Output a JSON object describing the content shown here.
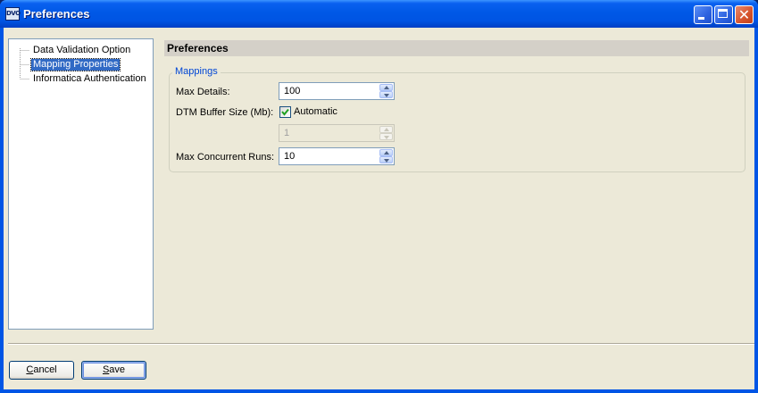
{
  "window": {
    "title": "Preferences",
    "app_icon_text": "DVO",
    "close_glyph": "✕"
  },
  "tree": {
    "items": [
      {
        "label": "Data Validation Option",
        "selected": false
      },
      {
        "label": "Mapping Properties",
        "selected": true
      },
      {
        "label": "Informatica Authentication",
        "selected": false
      }
    ]
  },
  "panel": {
    "header": "Preferences",
    "group_label": "Mappings",
    "max_details_label": "Max Details:",
    "max_details_value": "100",
    "dtm_buffer_label": "DTM Buffer Size (Mb):",
    "automatic_label": "Automatic",
    "automatic_checked": true,
    "dtm_buffer_value": "1",
    "max_concurrent_label": "Max Concurrent Runs:",
    "max_concurrent_value": "10"
  },
  "buttons": {
    "cancel_label_first": "C",
    "cancel_label_rest": "ancel",
    "save_label_first": "S",
    "save_label_rest": "ave"
  },
  "colors": {
    "title_bar": "#0054e3",
    "dialog_bg": "#ece9d8",
    "selection": "#316ac5",
    "group_title": "#0046d5"
  }
}
